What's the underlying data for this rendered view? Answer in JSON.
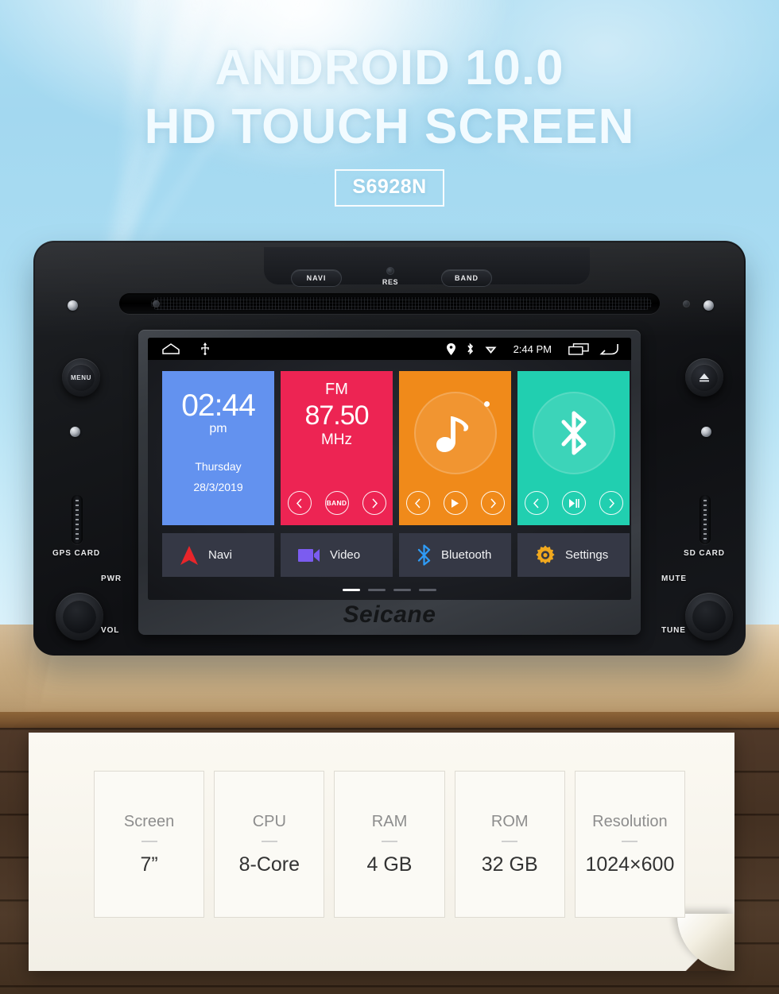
{
  "hero": {
    "line1": "ANDROID 10.0",
    "line2": "HD TOUCH SCREEN",
    "model": "S6928N"
  },
  "device": {
    "brand": "Seicane",
    "top_buttons": {
      "navi": "NAVI",
      "band": "BAND",
      "reset": "RES"
    },
    "left_side": {
      "menu_knob": "MENU",
      "card_slot": "GPS CARD",
      "knob_top": "PWR",
      "knob_bottom": "VOL"
    },
    "right_side": {
      "eject_knob": "eject-icon",
      "card_slot": "SD CARD",
      "knob_top": "MUTE",
      "knob_bottom": "TUNE"
    }
  },
  "screen": {
    "statusbar": {
      "left_icons": [
        "home-icon",
        "usb-icon"
      ],
      "right_icons": [
        "location-pin-icon",
        "bluetooth-icon",
        "wifi-icon"
      ],
      "time": "2:44 PM",
      "trailing_icons": [
        "recents-icon",
        "back-icon"
      ]
    },
    "tiles": [
      {
        "name": "clock",
        "color": "#6392ef",
        "time": "02:44",
        "ampm": "pm",
        "weekday": "Thursday",
        "date": "28/3/2019"
      },
      {
        "name": "radio",
        "color": "#ed2453",
        "band": "FM",
        "frequency": "87.50",
        "unit": "MHz",
        "controls": [
          "prev",
          "BAND",
          "next"
        ]
      },
      {
        "name": "music",
        "color": "#f08a1a",
        "icon": "music-note-icon",
        "controls": [
          "prev",
          "play",
          "next"
        ]
      },
      {
        "name": "bluetooth",
        "color": "#21cfb0",
        "icon": "bluetooth-icon",
        "controls": [
          "prev",
          "play-pause",
          "next"
        ]
      }
    ],
    "apps": [
      {
        "label": "Navi",
        "icon": "navigation-arrow-icon",
        "color": "#e8252a"
      },
      {
        "label": "Video",
        "icon": "video-camera-icon",
        "color": "#7b5cf0"
      },
      {
        "label": "Bluetooth",
        "icon": "bluetooth-icon",
        "color": "#2f9bf5"
      },
      {
        "label": "Settings",
        "icon": "gear-icon",
        "color": "#f0a81e"
      }
    ],
    "page_dots": {
      "count": 4,
      "active_index": 0
    }
  },
  "specs": [
    {
      "label": "Screen",
      "value": "7”"
    },
    {
      "label": "CPU",
      "value": "8-Core"
    },
    {
      "label": "RAM",
      "value": "4 GB"
    },
    {
      "label": "ROM",
      "value": "32 GB"
    },
    {
      "label": "Resolution",
      "value": "1024×600"
    }
  ]
}
